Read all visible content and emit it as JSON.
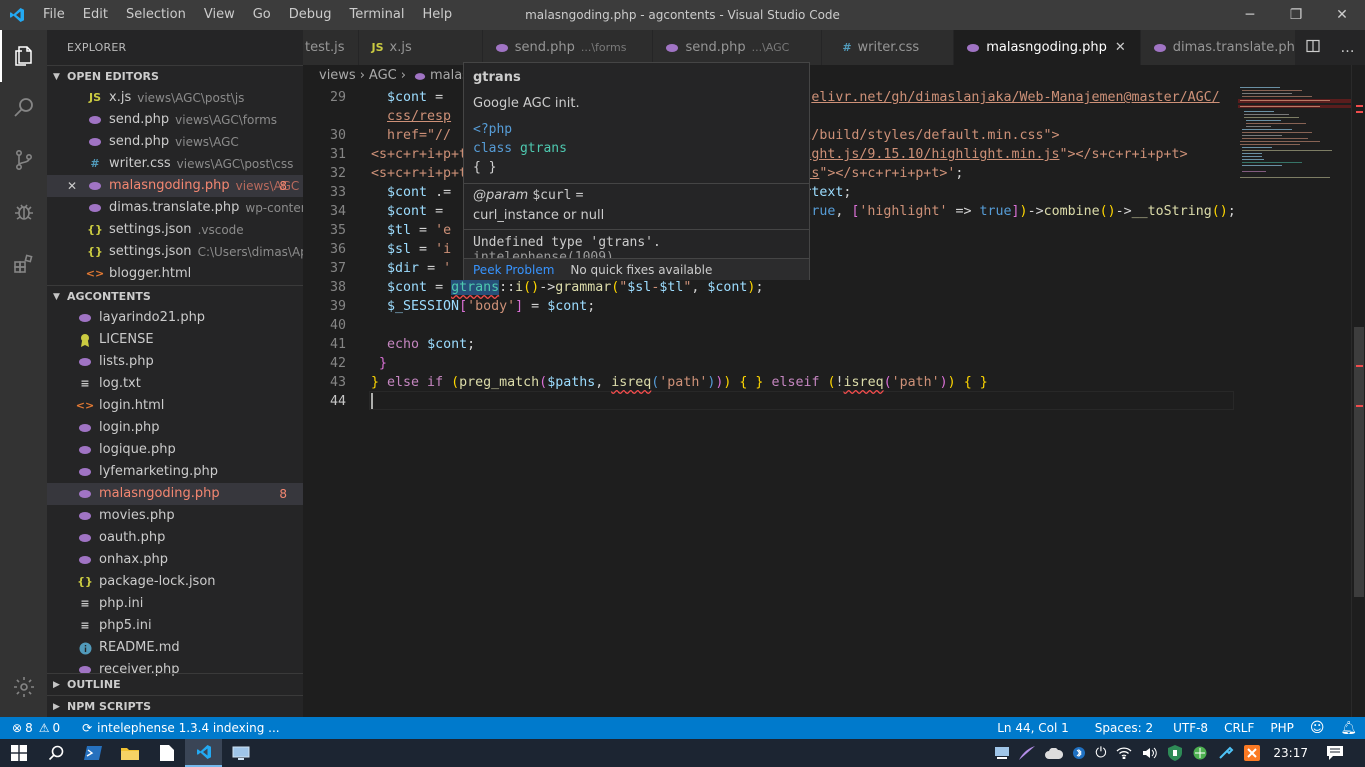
{
  "window": {
    "title": "malasngoding.php - agcontents - Visual Studio Code",
    "menu": [
      "File",
      "Edit",
      "Selection",
      "View",
      "Go",
      "Debug",
      "Terminal",
      "Help"
    ]
  },
  "sidebar": {
    "header": "EXPLORER",
    "open_editors_title": "OPEN EDITORS",
    "open_editors": [
      {
        "icon": "js",
        "name": "x.js",
        "desc": "views\\AGC\\post\\js"
      },
      {
        "icon": "php",
        "name": "send.php",
        "desc": "views\\AGC\\forms"
      },
      {
        "icon": "php",
        "name": "send.php",
        "desc": "views\\AGC"
      },
      {
        "icon": "css",
        "name": "writer.css",
        "desc": "views\\AGC\\post\\css"
      },
      {
        "icon": "php",
        "name": "malasngoding.php",
        "desc": "views\\AGC",
        "badge": "8"
      },
      {
        "icon": "php",
        "name": "dimas.translate.php",
        "desc": "wp-content\\p..."
      },
      {
        "icon": "json",
        "name": "settings.json",
        "desc": ".vscode"
      },
      {
        "icon": "json",
        "name": "settings.json",
        "desc": "C:\\Users\\dimas\\AppD..."
      },
      {
        "icon": "html",
        "name": "blogger.html",
        "desc": ""
      }
    ],
    "project_title": "AGCONTENTS",
    "files": [
      {
        "icon": "php",
        "name": "layarindo21.php"
      },
      {
        "icon": "license",
        "name": "LICENSE"
      },
      {
        "icon": "php",
        "name": "lists.php"
      },
      {
        "icon": "txt",
        "name": "log.txt"
      },
      {
        "icon": "html",
        "name": "login.html"
      },
      {
        "icon": "php",
        "name": "login.php"
      },
      {
        "icon": "php",
        "name": "logique.php"
      },
      {
        "icon": "php",
        "name": "lyfemarketing.php"
      },
      {
        "icon": "php",
        "name": "malasngoding.php",
        "badge": "8"
      },
      {
        "icon": "php",
        "name": "movies.php"
      },
      {
        "icon": "php",
        "name": "oauth.php"
      },
      {
        "icon": "php",
        "name": "onhax.php"
      },
      {
        "icon": "json",
        "name": "package-lock.json"
      },
      {
        "icon": "txt",
        "name": "php.ini"
      },
      {
        "icon": "txt",
        "name": "php5.ini"
      },
      {
        "icon": "info",
        "name": "README.md"
      },
      {
        "icon": "php",
        "name": "receiver.php"
      }
    ],
    "outline_title": "OUTLINE",
    "npm_title": "NPM SCRIPTS"
  },
  "tabs": [
    {
      "icon": "",
      "name": "test.js",
      "desc": ""
    },
    {
      "icon": "js",
      "name": "x.js",
      "desc": ""
    },
    {
      "icon": "php",
      "name": "send.php",
      "desc": "...\\forms"
    },
    {
      "icon": "php",
      "name": "send.php",
      "desc": "...\\AGC"
    },
    {
      "icon": "css",
      "name": "writer.css",
      "desc": ""
    },
    {
      "icon": "php",
      "name": "malasngoding.php",
      "desc": "",
      "active": true
    },
    {
      "icon": "php",
      "name": "dimas.translate.php",
      "desc": ""
    }
  ],
  "breadcrumb": [
    "views",
    "AGC",
    "malas"
  ],
  "editor": {
    "line_numbers": [
      "29",
      "",
      "30",
      "31",
      "32",
      "33",
      "34",
      "35",
      "36",
      "37",
      "38",
      "39",
      "40",
      "41",
      "42",
      "43",
      "44"
    ]
  },
  "hover": {
    "title": "gtrans",
    "description": "Google AGC init.",
    "code_open": "<?php",
    "code_class_kw": "class",
    "code_class_name": "gtrans",
    "code_braces": "{ }",
    "param_tag": "@param",
    "param_var": "$curl",
    "param_eq": "=",
    "param_desc": "curl_instance or null",
    "problem": "Undefined type 'gtrans'.",
    "problem_source": "intelephense(1009)",
    "peek_label": "Peek Problem",
    "no_fixes": "No quick fixes available"
  },
  "statusbar": {
    "errors": "8",
    "warnings": "0",
    "indexing": "intelephense 1.3.4 indexing ...",
    "position": "Ln 44, Col 1",
    "spaces": "Spaces: 2",
    "encoding": "UTF-8",
    "eol": "CRLF",
    "language": "PHP"
  },
  "taskbar": {
    "clock": "23:17"
  },
  "colors": {
    "accent": "#007acc",
    "error": "#f48771",
    "php_icon": "#a074c4",
    "js_icon": "#cbcb41"
  }
}
